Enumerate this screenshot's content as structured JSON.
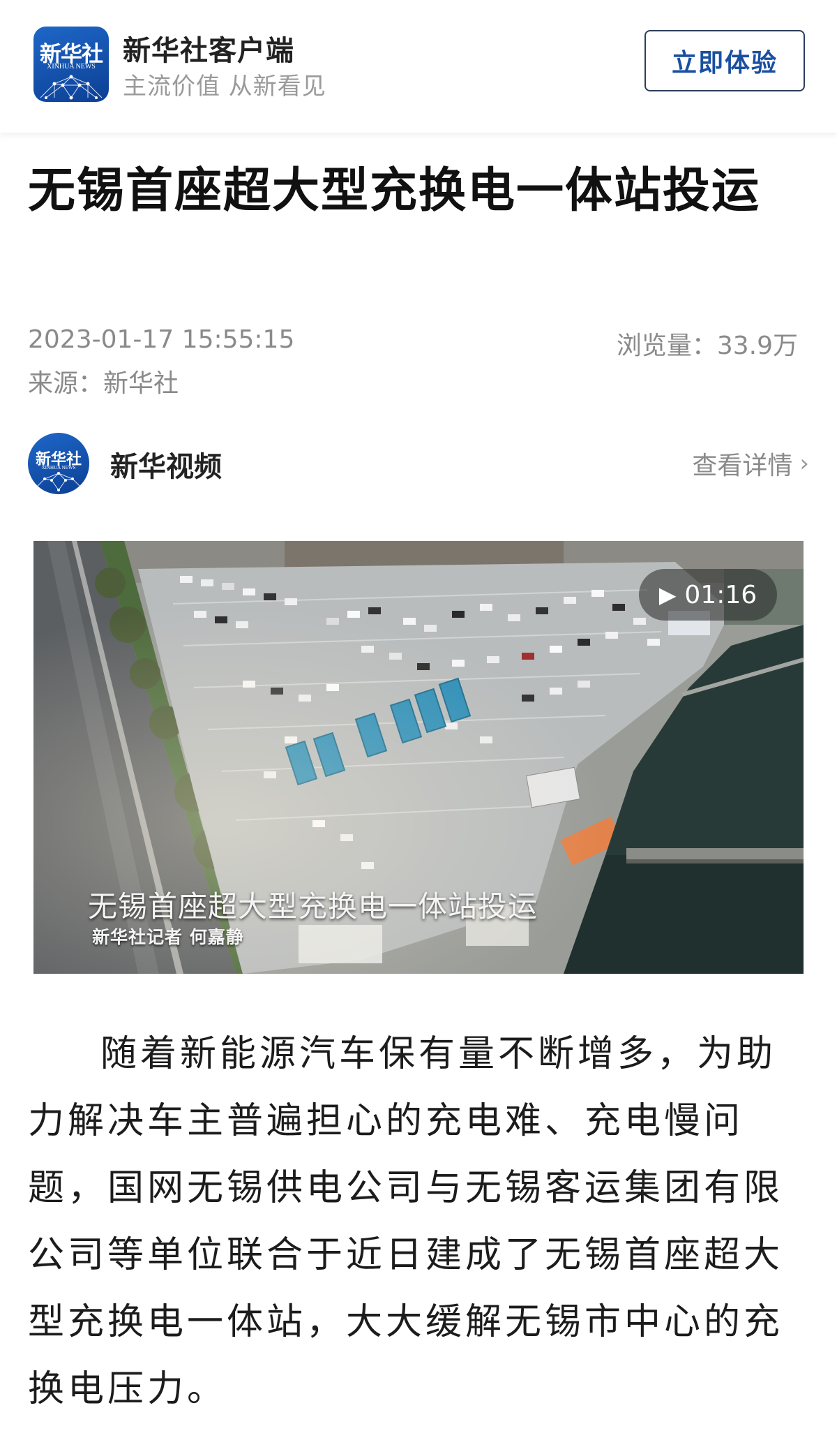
{
  "banner": {
    "logo_cn": "新华社",
    "logo_en": "XINHUA NEWS",
    "app_name": "新华社客户端",
    "slogan": "主流价值 从新看见",
    "try_button": "立即体验"
  },
  "article": {
    "title": "无锡首座超大型充换电一体站投运",
    "date": "2023-01-17 15:55:15",
    "views": "浏览量：33.9万",
    "source": "来源：新华社"
  },
  "channel": {
    "avatar_cn": "新华社",
    "avatar_en": "XINHUA NEWS",
    "name": "新华视频",
    "details_label": "查看详情",
    "chevron_icon": "chevron-right-icon"
  },
  "video": {
    "duration": "01:16",
    "play_icon": "play-icon",
    "caption": "无锡首座超大型充换电一体站投运",
    "reporter": "新华社记者 何嘉静"
  },
  "body": {
    "paragraph": "随着新能源汽车保有量不断增多，为助力解决车主普遍担心的充电难、充电慢问题，国网无锡供电公司与无锡客运集团有限公司等单位联合于近日建成了无锡首座超大型充换电一体站，大大缓解无锡市中心的充换电压力。"
  },
  "colors": {
    "brand_blue": "#1a5bb5",
    "button_text": "#1a4fa0",
    "meta_gray": "#8a8a8a"
  }
}
